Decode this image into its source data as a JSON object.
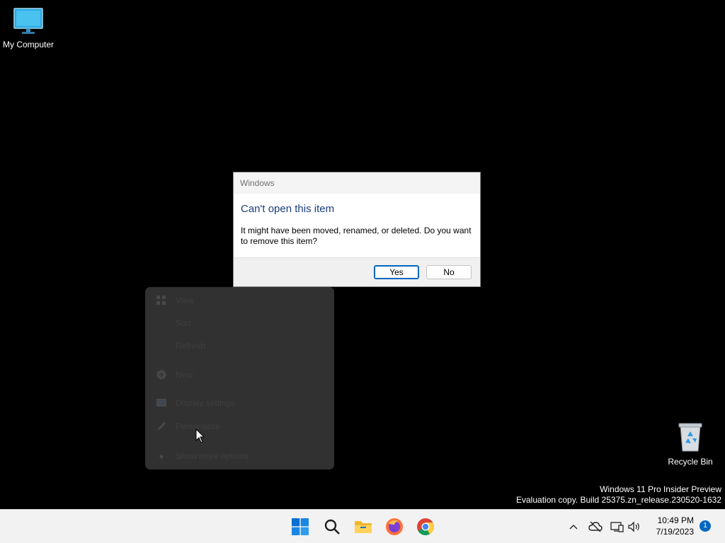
{
  "desktop": {
    "icons": [
      {
        "label": "My Computer",
        "icon": "monitor-icon"
      },
      {
        "label": "Recycle Bin",
        "icon": "recycle-bin-icon"
      }
    ],
    "watermark": {
      "line1": "Windows 11 Pro Insider Preview",
      "line2": "Evaluation copy. Build 25375.zn_release.230520-1632"
    }
  },
  "dialog": {
    "title": "Windows",
    "main_instruction": "Can't open this item",
    "message": "It might have been moved, renamed, or deleted. Do you want to remove this item?",
    "buttons": {
      "yes": "Yes",
      "no": "No"
    },
    "accent_color": "#1b3d7d"
  },
  "context_menu": {
    "items": [
      {
        "label": "View",
        "icon": "grid-icon"
      },
      {
        "label": "Sort",
        "icon": ""
      },
      {
        "label": "Refresh",
        "icon": ""
      },
      {
        "label": "New",
        "icon": "plus-circle-icon"
      },
      {
        "label": "Display settings",
        "icon": "display-icon"
      },
      {
        "label": "Personalize",
        "icon": "pen-icon"
      },
      {
        "label": "Show more options",
        "icon": "dot-icon"
      }
    ]
  },
  "taskbar": {
    "apps": [
      "windows-start-icon",
      "search-icon",
      "file-explorer-icon",
      "firefox-icon",
      "chrome-icon"
    ],
    "tray": [
      "chevron-up-icon",
      "cloud-off-icon",
      "network-icon",
      "volume-icon"
    ],
    "clock": {
      "time": "10:49 PM",
      "date": "7/19/2023"
    },
    "notification_count": "1",
    "accent_color": "#0067c0"
  }
}
